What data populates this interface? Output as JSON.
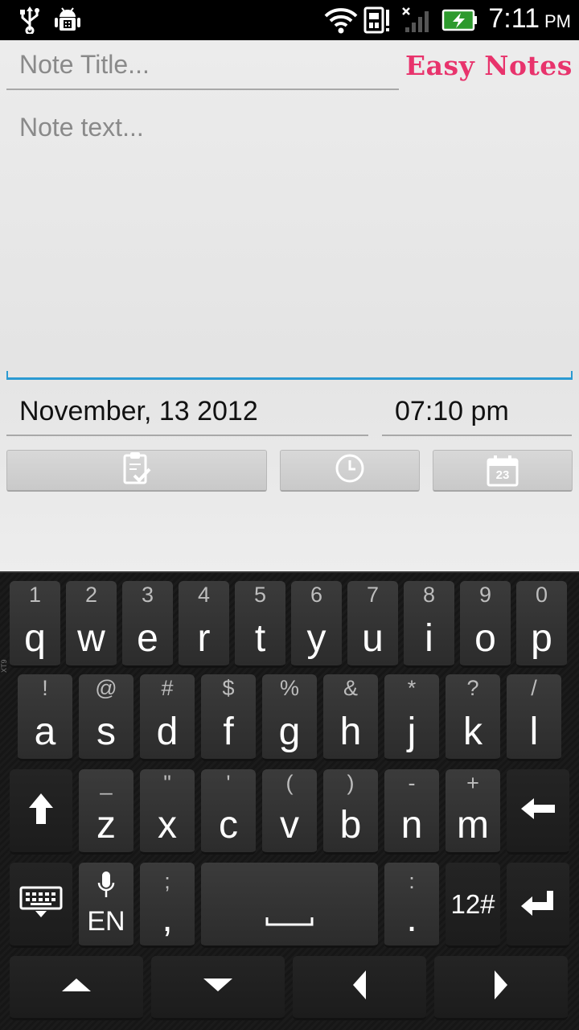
{
  "status_bar": {
    "time": "7:11",
    "ampm": "PM",
    "icons": [
      "usb-icon",
      "android-debug-icon",
      "wifi-icon",
      "sim-alert-icon",
      "no-signal-icon",
      "battery-charging-icon"
    ]
  },
  "note": {
    "title_placeholder": "Note Title...",
    "text_placeholder": "Note text...",
    "brand": "Easy Notes",
    "date": "November, 13 2012",
    "time": "07:10 pm"
  },
  "actions": {
    "save_icon": "clipboard-check-icon",
    "time_icon": "clock-icon",
    "date_icon": "calendar-icon",
    "calendar_day": "23"
  },
  "keyboard": {
    "side_label": "XT9",
    "row1": [
      {
        "sub": "1",
        "main": "q"
      },
      {
        "sub": "2",
        "main": "w"
      },
      {
        "sub": "3",
        "main": "e"
      },
      {
        "sub": "4",
        "main": "r"
      },
      {
        "sub": "5",
        "main": "t"
      },
      {
        "sub": "6",
        "main": "y"
      },
      {
        "sub": "7",
        "main": "u"
      },
      {
        "sub": "8",
        "main": "i"
      },
      {
        "sub": "9",
        "main": "o"
      },
      {
        "sub": "0",
        "main": "p"
      }
    ],
    "row2": [
      {
        "sub": "!",
        "main": "a"
      },
      {
        "sub": "@",
        "main": "s"
      },
      {
        "sub": "#",
        "main": "d"
      },
      {
        "sub": "$",
        "main": "f"
      },
      {
        "sub": "%",
        "main": "g"
      },
      {
        "sub": "&",
        "main": "h"
      },
      {
        "sub": "*",
        "main": "j"
      },
      {
        "sub": "?",
        "main": "k"
      },
      {
        "sub": "/",
        "main": "l"
      }
    ],
    "row3": [
      {
        "sub": "_",
        "main": "z"
      },
      {
        "sub": "\"",
        "main": "x"
      },
      {
        "sub": "'",
        "main": "c"
      },
      {
        "sub": "(",
        "main": "v"
      },
      {
        "sub": ")",
        "main": "b"
      },
      {
        "sub": "-",
        "main": "n"
      },
      {
        "sub": "+",
        "main": "m"
      }
    ],
    "row4": {
      "lang": "EN",
      "comma_sub": ";",
      "comma_main": ",",
      "period_sub": ":",
      "period_main": ".",
      "symbols": "12#"
    }
  }
}
